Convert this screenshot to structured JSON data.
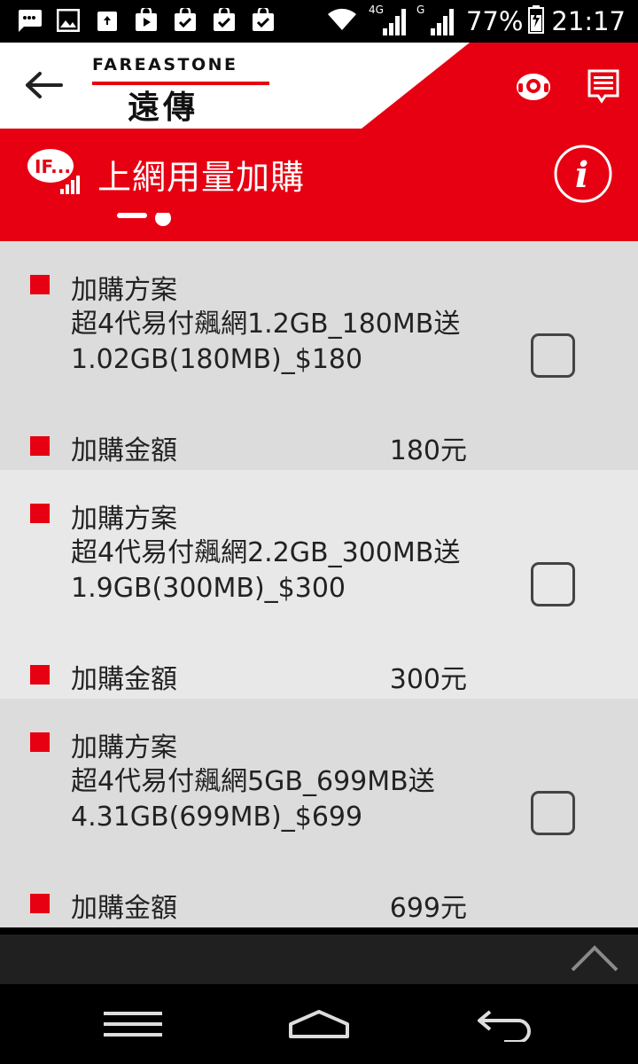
{
  "status_bar": {
    "battery": "77%",
    "time": "21:17",
    "network_4g": "4G",
    "network_g": "G"
  },
  "header": {
    "logo_en": "FAREASTONE",
    "logo_zh": "遠傳"
  },
  "title_bar": {
    "title": "上網用量加購"
  },
  "plans": [
    {
      "plan_label": "加購方案",
      "plan_name": "超4代易付飆網1.2GB_180MB送1.02GB(180MB)_$180",
      "amount_label": "加購金額",
      "amount": "180元",
      "checked": false
    },
    {
      "plan_label": "加購方案",
      "plan_name": "超4代易付飆網2.2GB_300MB送1.9GB(300MB)_$300",
      "amount_label": "加購金額",
      "amount": "300元",
      "checked": false
    },
    {
      "plan_label": "加購方案",
      "plan_name": "超4代易付飆網5GB_699MB送4.31GB(699MB)_$699",
      "amount_label": "加購金額",
      "amount": "699元",
      "checked": false
    }
  ],
  "colors": {
    "brand_red": "#e60012",
    "card_dark": "#dcdcdc",
    "card_light": "#e8e8e8"
  }
}
